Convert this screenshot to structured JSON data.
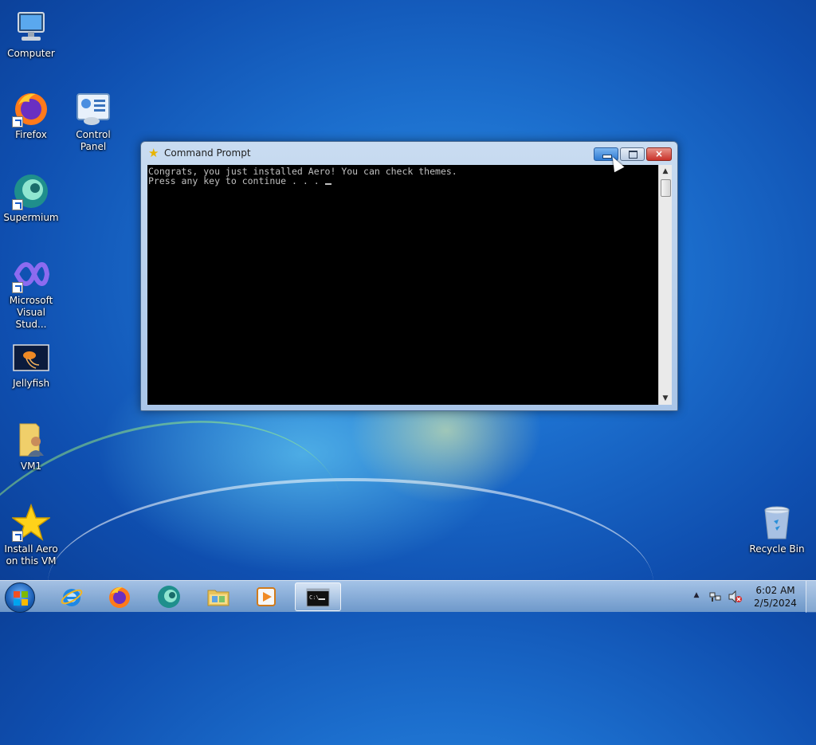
{
  "desktop": {
    "icons": [
      {
        "label": "Computer",
        "icon": "computer-icon"
      },
      {
        "label": "Firefox",
        "icon": "firefox-icon"
      },
      {
        "label": "Control Panel",
        "icon": "control-panel-icon"
      },
      {
        "label": "Supermium",
        "icon": "supermium-icon"
      },
      {
        "label": "Microsoft Visual Stud...",
        "icon": "visual-studio-icon"
      },
      {
        "label": "Jellyfish",
        "icon": "image-file-icon"
      },
      {
        "label": "VM1",
        "icon": "user-folder-icon"
      },
      {
        "label": "Install Aero on this VM",
        "icon": "star-icon"
      },
      {
        "label": "Recycle Bin",
        "icon": "recycle-bin-icon"
      }
    ]
  },
  "window": {
    "title": "Command Prompt",
    "icon": "star-icon",
    "console_lines": [
      "Congrats, you just installed Aero! You can check themes.",
      "Press any key to continue . . . "
    ],
    "controls": {
      "minimize": "minimize",
      "maximize": "maximize",
      "close": "×"
    }
  },
  "taskbar": {
    "items": [
      {
        "name": "internet-explorer",
        "icon": "internet-explorer-icon"
      },
      {
        "name": "firefox",
        "icon": "firefox-icon"
      },
      {
        "name": "supermium",
        "icon": "supermium-icon"
      },
      {
        "name": "file-explorer",
        "icon": "folder-icon"
      },
      {
        "name": "media-player",
        "icon": "media-player-icon"
      },
      {
        "name": "command-prompt",
        "icon": "command-prompt-icon",
        "active": true
      }
    ],
    "clock": {
      "time": "6:02 AM",
      "date": "2/5/2024"
    },
    "tray_arrow": "▲"
  },
  "colors": {
    "console_bg": "#000000",
    "console_text": "#c0c0c0",
    "accent": "#1c6fce"
  }
}
